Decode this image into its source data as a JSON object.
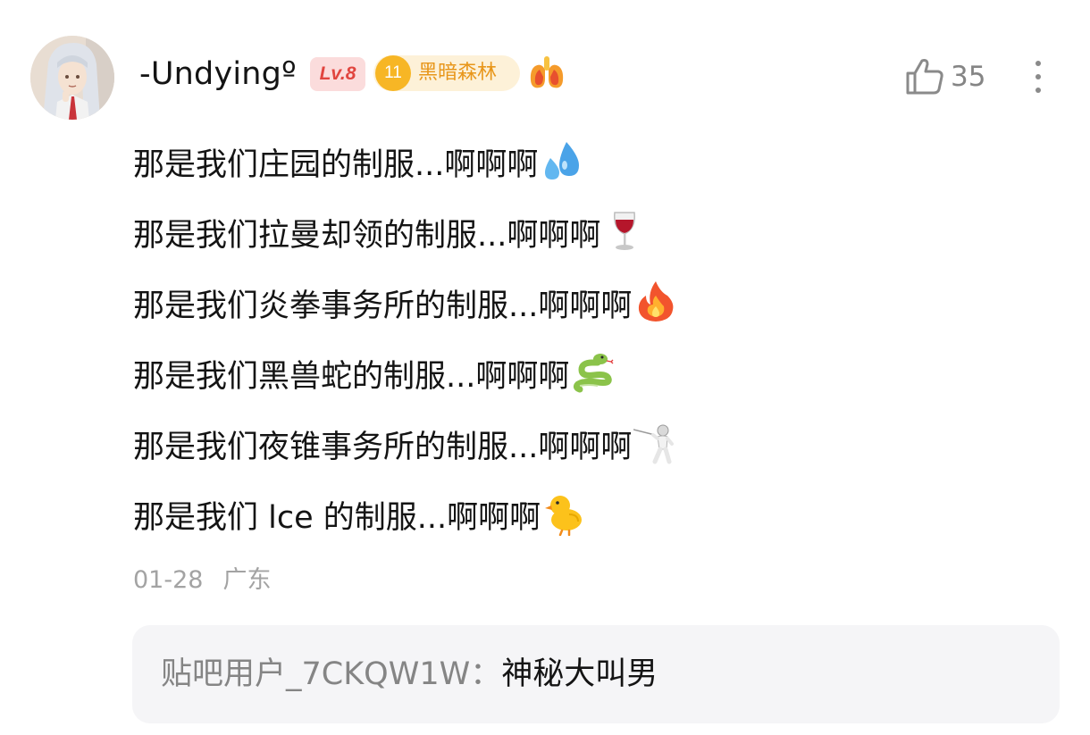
{
  "comment": {
    "author": "-Undyingº",
    "level_badge": "Lv.8",
    "forum_badge": {
      "level": "11",
      "name": "黑暗森林"
    },
    "like_count": "35",
    "lines": [
      {
        "text": "那是我们庄园的制服...啊啊啊",
        "emoji": "sweat-droplets-emoji"
      },
      {
        "text": "那是我们拉曼却领的制服...啊啊啊",
        "emoji": "wine-glass-emoji"
      },
      {
        "text": "那是我们炎拳事务所的制服...啊啊啊",
        "emoji": "fire-emoji"
      },
      {
        "text": "那是我们黑兽蛇的制服...啊啊啊",
        "emoji": "snake-emoji"
      },
      {
        "text": "那是我们夜锥事务所的制服...啊啊啊",
        "emoji": "fencer-emoji"
      },
      {
        "text": "那是我们 lce 的制服...啊啊啊",
        "emoji": "baby-chick-emoji"
      }
    ],
    "date": "01-28",
    "location": "广东"
  },
  "reply": {
    "user": "贴吧用户_7CKQW1W",
    "separator": "：",
    "content": "神秘大叫男"
  },
  "icons": {
    "like": "thumbs-up-icon",
    "more": "more-vertical-icon",
    "medal": "lungs-medal-icon"
  },
  "colors": {
    "level_badge_bg": "#fbdcdc",
    "level_badge_text": "#e1453f",
    "forum_badge_bg": "#fdf1d8",
    "forum_badge_text": "#e8961a",
    "meta_text": "#a3a3a3",
    "reply_bg": "#f5f5f7"
  }
}
